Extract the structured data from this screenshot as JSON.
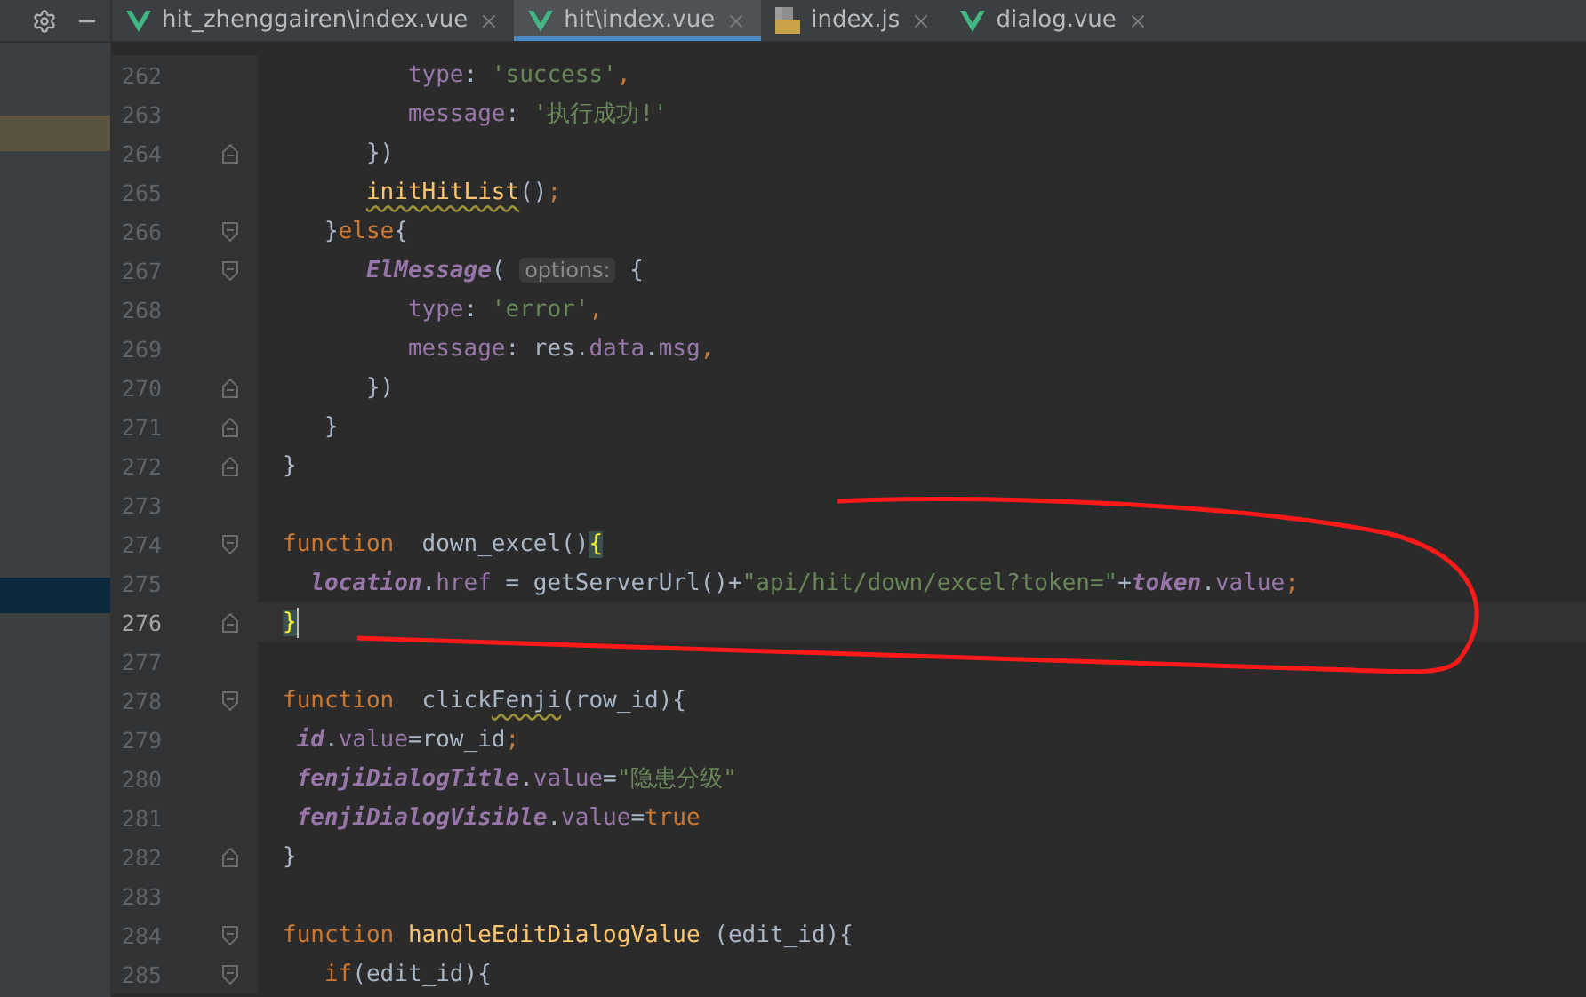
{
  "tabs": [
    {
      "label": "hit_zhenggairen\\index.vue",
      "kind": "vue",
      "selected": false
    },
    {
      "label": "hit\\index.vue",
      "kind": "vue",
      "selected": true
    },
    {
      "label": "index.js",
      "kind": "js",
      "selected": false
    },
    {
      "label": "dialog.vue",
      "kind": "vue",
      "selected": false
    }
  ],
  "sidebar": {
    "rows": [
      {
        "selected": false,
        "highlighted": false
      },
      {
        "selected": false,
        "highlighted": false
      },
      {
        "selected": false,
        "highlighted": true
      },
      {
        "selected": false,
        "highlighted": false
      },
      {
        "selected": false,
        "highlighted": false
      },
      {
        "selected": false,
        "highlighted": false
      },
      {
        "selected": false,
        "highlighted": false
      },
      {
        "selected": false,
        "highlighted": false
      },
      {
        "selected": false,
        "highlighted": false
      },
      {
        "selected": false,
        "highlighted": false
      },
      {
        "selected": false,
        "highlighted": false
      },
      {
        "selected": false,
        "highlighted": false
      },
      {
        "selected": false,
        "highlighted": false
      },
      {
        "selected": false,
        "highlighted": false
      },
      {
        "selected": false,
        "highlighted": false
      },
      {
        "selected": true,
        "highlighted": false
      },
      {
        "selected": false,
        "highlighted": false
      },
      {
        "selected": false,
        "highlighted": false
      },
      {
        "selected": false,
        "highlighted": false
      },
      {
        "selected": false,
        "highlighted": false
      },
      {
        "selected": false,
        "highlighted": false
      },
      {
        "selected": false,
        "highlighted": false
      },
      {
        "selected": false,
        "highlighted": false
      },
      {
        "selected": false,
        "highlighted": false
      },
      {
        "selected": false,
        "highlighted": false
      },
      {
        "selected": false,
        "highlighted": false
      },
      {
        "selected": false,
        "highlighted": false
      }
    ]
  },
  "editor": {
    "lines": [
      {
        "number": "262",
        "fold_start": false,
        "fold_end": false,
        "current": false,
        "tokens": [
          {
            "kind": "prop",
            "text": "         type"
          },
          {
            "kind": "text",
            "text": ": "
          },
          {
            "kind": "str",
            "text": "'success'"
          },
          {
            "kind": "kw",
            "text": ","
          }
        ]
      },
      {
        "number": "263",
        "fold_start": false,
        "fold_end": false,
        "current": false,
        "tokens": [
          {
            "kind": "prop",
            "text": "         message"
          },
          {
            "kind": "text",
            "text": ": "
          },
          {
            "kind": "str",
            "text": "'执行成功!'"
          }
        ]
      },
      {
        "number": "264",
        "fold_start": false,
        "fold_end": true,
        "current": false,
        "tokens": [
          {
            "kind": "text",
            "text": "      })"
          }
        ]
      },
      {
        "number": "265",
        "fold_start": false,
        "fold_end": false,
        "current": false,
        "tokens": [
          {
            "kind": "fnw",
            "text": "      initHitList"
          },
          {
            "kind": "text",
            "text": "()"
          },
          {
            "kind": "kw",
            "text": ";"
          }
        ]
      },
      {
        "number": "266",
        "fold_start": true,
        "fold_end": false,
        "current": false,
        "tokens": [
          {
            "kind": "text",
            "text": "   }"
          },
          {
            "kind": "kw",
            "text": "else"
          },
          {
            "kind": "text",
            "text": "{"
          }
        ]
      },
      {
        "number": "267",
        "fold_start": true,
        "fold_end": false,
        "current": false,
        "tokens": [
          {
            "kind": "ivar",
            "text": "      ElMessage"
          },
          {
            "kind": "text",
            "text": "( "
          },
          {
            "kind": "hint",
            "text": "options:"
          },
          {
            "kind": "text",
            "text": " {"
          }
        ]
      },
      {
        "number": "268",
        "fold_start": false,
        "fold_end": false,
        "current": false,
        "tokens": [
          {
            "kind": "prop",
            "text": "         type"
          },
          {
            "kind": "text",
            "text": ": "
          },
          {
            "kind": "str",
            "text": "'error'"
          },
          {
            "kind": "kw",
            "text": ","
          }
        ]
      },
      {
        "number": "269",
        "fold_start": false,
        "fold_end": false,
        "current": false,
        "tokens": [
          {
            "kind": "prop",
            "text": "         message"
          },
          {
            "kind": "text",
            "text": ": res."
          },
          {
            "kind": "prop",
            "text": "data"
          },
          {
            "kind": "text",
            "text": "."
          },
          {
            "kind": "prop",
            "text": "msg"
          },
          {
            "kind": "kw",
            "text": ","
          }
        ]
      },
      {
        "number": "270",
        "fold_start": false,
        "fold_end": true,
        "current": false,
        "tokens": [
          {
            "kind": "text",
            "text": "      })"
          }
        ]
      },
      {
        "number": "271",
        "fold_start": false,
        "fold_end": true,
        "current": false,
        "tokens": [
          {
            "kind": "text",
            "text": "   }"
          }
        ]
      },
      {
        "number": "272",
        "fold_start": false,
        "fold_end": true,
        "current": false,
        "tokens": [
          {
            "kind": "text",
            "text": "}"
          }
        ]
      },
      {
        "number": "273",
        "fold_start": false,
        "fold_end": false,
        "current": false
      },
      {
        "number": "274",
        "fold_start": true,
        "fold_end": false,
        "current": false,
        "tokens": [
          {
            "kind": "kw",
            "text": "function"
          },
          {
            "kind": "text",
            "text": "  down_excel()"
          },
          {
            "kind": "match",
            "text": "{"
          }
        ]
      },
      {
        "number": "275",
        "fold_start": false,
        "fold_end": false,
        "current": false,
        "tokens": [
          {
            "kind": "ivar",
            "text": "  location"
          },
          {
            "kind": "text",
            "text": "."
          },
          {
            "kind": "prop",
            "text": "href"
          },
          {
            "kind": "text",
            "text": " = getServerUrl()+"
          },
          {
            "kind": "str",
            "text": "\"api/hit/down/excel?token=\""
          },
          {
            "kind": "text",
            "text": "+"
          },
          {
            "kind": "ivar",
            "text": "token"
          },
          {
            "kind": "text",
            "text": "."
          },
          {
            "kind": "prop",
            "text": "value"
          },
          {
            "kind": "kw",
            "text": ";"
          }
        ]
      },
      {
        "number": "276",
        "fold_start": false,
        "fold_end": true,
        "current": true,
        "tokens": [
          {
            "kind": "match",
            "text": "}"
          }
        ]
      },
      {
        "number": "277",
        "fold_start": false,
        "fold_end": false,
        "current": false
      },
      {
        "number": "278",
        "fold_start": true,
        "fold_end": false,
        "current": false,
        "tokens": [
          {
            "kind": "kw",
            "text": "function"
          },
          {
            "kind": "text",
            "text": "  click"
          },
          {
            "kind": "warn",
            "text": "Fenji"
          },
          {
            "kind": "text",
            "text": "(row_id){"
          }
        ]
      },
      {
        "number": "279",
        "fold_start": false,
        "fold_end": false,
        "current": false,
        "tokens": [
          {
            "kind": "ivar",
            "text": " id"
          },
          {
            "kind": "text",
            "text": "."
          },
          {
            "kind": "prop",
            "text": "value"
          },
          {
            "kind": "text",
            "text": "=row_id"
          },
          {
            "kind": "kw",
            "text": ";"
          }
        ]
      },
      {
        "number": "280",
        "fold_start": false,
        "fold_end": false,
        "current": false,
        "tokens": [
          {
            "kind": "ivar",
            "text": " fenjiDialogTitle"
          },
          {
            "kind": "text",
            "text": "."
          },
          {
            "kind": "prop",
            "text": "value"
          },
          {
            "kind": "text",
            "text": "="
          },
          {
            "kind": "str",
            "text": "\"隐患分级\""
          }
        ]
      },
      {
        "number": "281",
        "fold_start": false,
        "fold_end": false,
        "current": false,
        "tokens": [
          {
            "kind": "ivar",
            "text": " fenjiDialogVisible"
          },
          {
            "kind": "text",
            "text": "."
          },
          {
            "kind": "prop",
            "text": "value"
          },
          {
            "kind": "text",
            "text": "="
          },
          {
            "kind": "kw",
            "text": "true"
          }
        ]
      },
      {
        "number": "282",
        "fold_start": false,
        "fold_end": true,
        "current": false,
        "tokens": [
          {
            "kind": "text",
            "text": "}"
          }
        ]
      },
      {
        "number": "283",
        "fold_start": false,
        "fold_end": false,
        "current": false
      },
      {
        "number": "284",
        "fold_start": true,
        "fold_end": false,
        "current": false,
        "tokens": [
          {
            "kind": "kw",
            "text": "function"
          },
          {
            "kind": "fn",
            "text": " handleEditDialogValue"
          },
          {
            "kind": "text",
            "text": " (edit_id){"
          }
        ]
      },
      {
        "number": "285",
        "fold_start": true,
        "fold_end": false,
        "current": false,
        "tokens": [
          {
            "kind": "kw",
            "text": "   if"
          },
          {
            "kind": "text",
            "text": "(edit_id){"
          }
        ]
      }
    ]
  }
}
